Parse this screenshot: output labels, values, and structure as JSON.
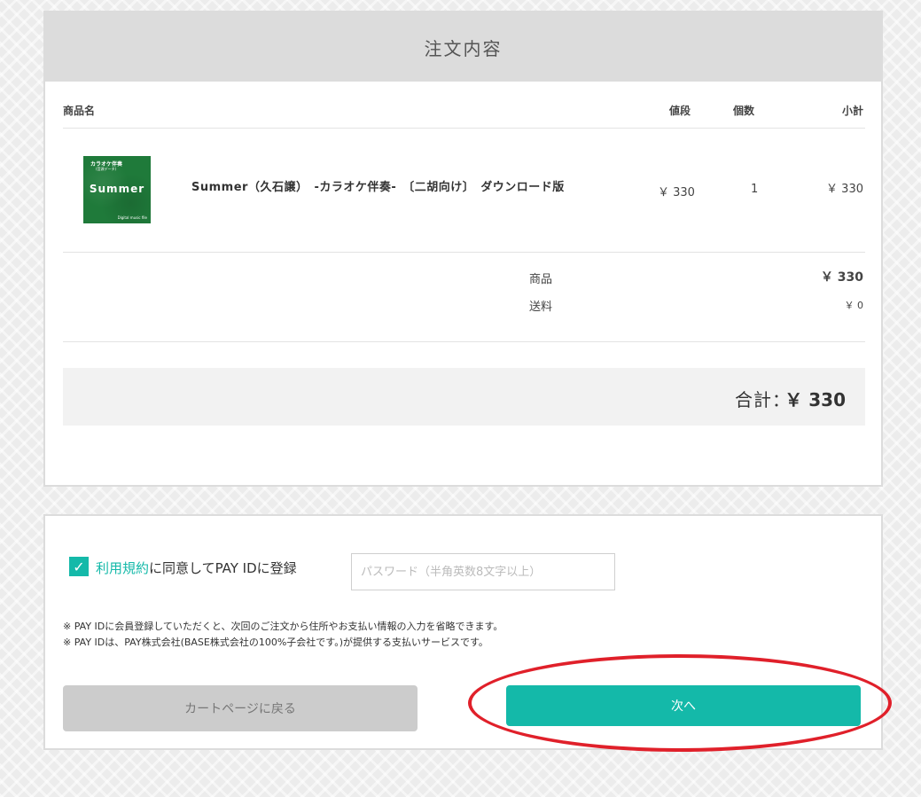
{
  "order": {
    "title": "注文内容",
    "columns": {
      "name": "商品名",
      "price": "値段",
      "qty": "個数",
      "subtotal": "小計"
    },
    "items": [
      {
        "name": "Summer（久石譲）　-カラオケ伴奏-　〔二胡向け〕　ダウンロード版",
        "price": "￥ 330",
        "qty": "1",
        "subtotal": "￥ 330",
        "thumb": {
          "line1": "カラオケ伴奏",
          "line2": "(音源データ)",
          "title": "Summer",
          "footer": "Digital music file"
        }
      }
    ],
    "summary": {
      "goods_label": "商品",
      "goods_value": "￥ 330",
      "shipping_label": "送料",
      "shipping_value": "￥ 0"
    },
    "total": {
      "label": "合計：",
      "value": "￥ 330"
    }
  },
  "member": {
    "checkbox_checked": true,
    "terms_link": "利用規約",
    "agree_text": "に同意してPAY IDに登録",
    "password_placeholder": "パスワード（半角英数8文字以上）",
    "note1": "※ PAY IDに会員登録していただくと、次回のご注文から住所やお支払い情報の入力を省略できます。",
    "note2": "※ PAY IDは、PAY株式会社(BASE株式会社の100%子会社です。)が提供する支払いサービスです。",
    "back_button": "カートページに戻る",
    "next_button": "次へ"
  },
  "colors": {
    "accent": "#14b9a9",
    "highlight": "#e0202a",
    "header": "#dcdcdc"
  }
}
